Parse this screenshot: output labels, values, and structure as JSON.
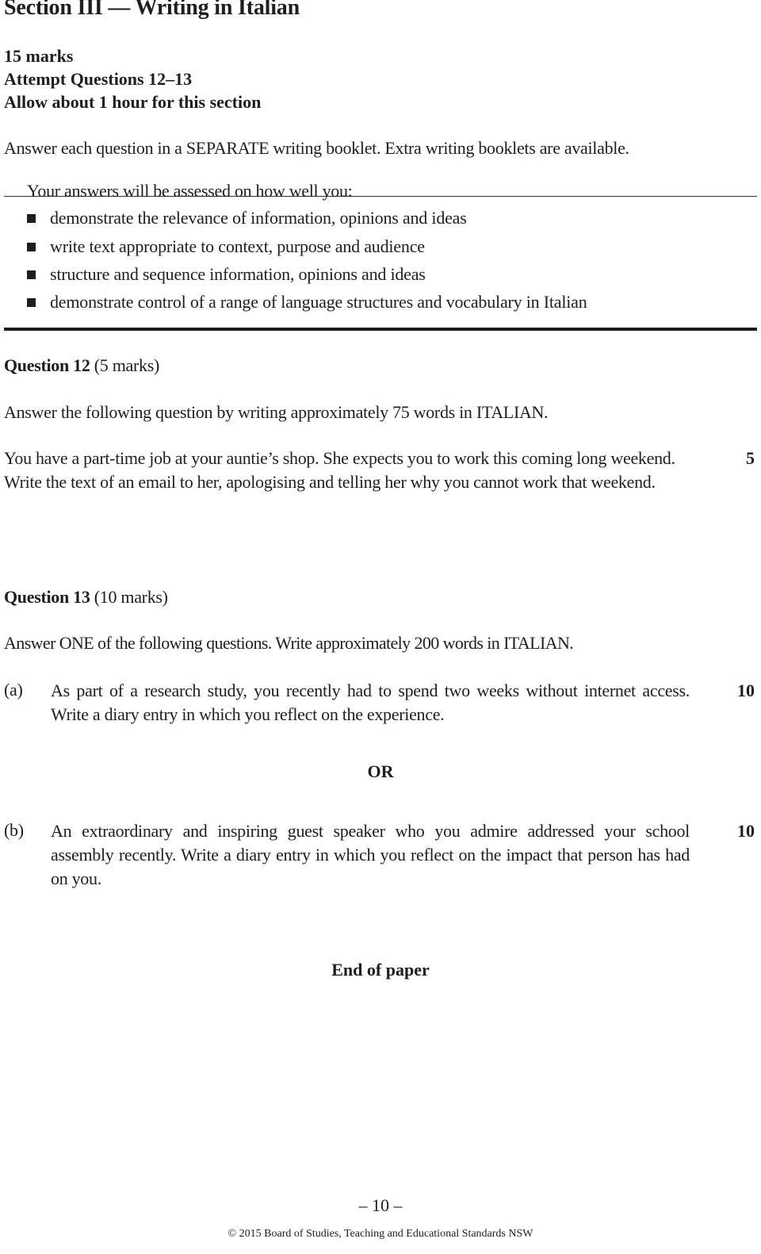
{
  "section": {
    "title": "Section III — Writing in Italian",
    "marks": "15 marks",
    "attempt": "Attempt Questions 12–13",
    "time": "Allow about 1 hour for this section",
    "instruction": "Answer each question in a SEPARATE writing booklet. Extra writing booklets are available."
  },
  "criteria": {
    "intro": "Your answers will be assessed on how well you:",
    "bullet_icon": "square-bullet-icon",
    "items": [
      "demonstrate the relevance of information, opinions and ideas",
      "write text appropriate to context, purpose and audience",
      "structure and sequence information, opinions and ideas",
      "demonstrate control of a range of language structures and vocabulary in Italian"
    ]
  },
  "question12": {
    "label": "Question 12",
    "marks_label": "(5 marks)",
    "instruction": "Answer the following question by writing approximately 75 words in ITALIAN.",
    "prompt": "You have a part-time job at your auntie’s shop. She expects you to work this coming long weekend. Write the text of an email to her, apologising and telling her why you cannot work that weekend.",
    "marks": "5"
  },
  "question13": {
    "label": "Question 13",
    "marks_label": "(10 marks)",
    "instruction": "Answer ONE of the following questions. Write approximately 200 words in ITALIAN.",
    "options": [
      {
        "label": "(a)",
        "text": "As part of a research study, you recently had to spend two weeks without internet access. Write a diary entry in which you reflect on the experience.",
        "marks": "10"
      },
      {
        "label": "(b)",
        "text": "An extraordinary and inspiring guest speaker who you admire addressed your school assembly recently. Write a diary entry in which you reflect on the impact that person has had on you.",
        "marks": "10"
      }
    ],
    "separator": "OR"
  },
  "end": "End of paper",
  "footer": {
    "page_number": "– 10 –",
    "copyright": "© 2015 Board of Studies, Teaching and Educational Standards NSW"
  }
}
